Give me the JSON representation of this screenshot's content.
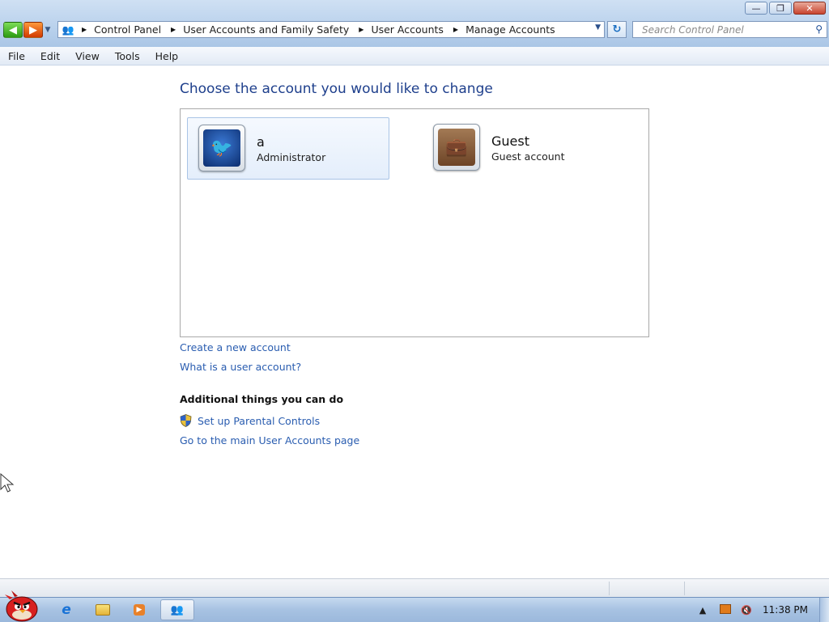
{
  "window": {
    "caption_buttons": {
      "minimize": "—",
      "maximize": "❐",
      "close": "✕"
    }
  },
  "navigation": {
    "back_icon": "back-arrow",
    "forward_icon": "forward-arrow"
  },
  "address_bar": {
    "breadcrumbs": [
      "Control Panel",
      "User Accounts and Family Safety",
      "User Accounts",
      "Manage Accounts"
    ]
  },
  "search": {
    "placeholder": "Search Control Panel"
  },
  "menu": {
    "items": [
      "File",
      "Edit",
      "View",
      "Tools",
      "Help"
    ]
  },
  "main": {
    "heading": "Choose the account you would like to change",
    "accounts": [
      {
        "name": "a",
        "type": "Administrator",
        "selected": true,
        "picture": "angry-bird-avatar"
      },
      {
        "name": "Guest",
        "type": "Guest account",
        "selected": false,
        "picture": "briefcase-avatar"
      }
    ],
    "links": {
      "create": "Create a new account",
      "what_is": "What is a user account?"
    },
    "additional": {
      "heading": "Additional things you can do",
      "parental": "Set up Parental Controls",
      "main_page": "Go to the main User Accounts page"
    }
  },
  "taskbar": {
    "clock": "11:38 PM",
    "pinned": [
      "internet-explorer-icon",
      "windows-explorer-icon",
      "media-player-icon",
      "user-accounts-window-icon"
    ]
  },
  "colors": {
    "link": "#2a5db0",
    "heading": "#1e3f8c",
    "chrome": "#b9d1ec"
  }
}
